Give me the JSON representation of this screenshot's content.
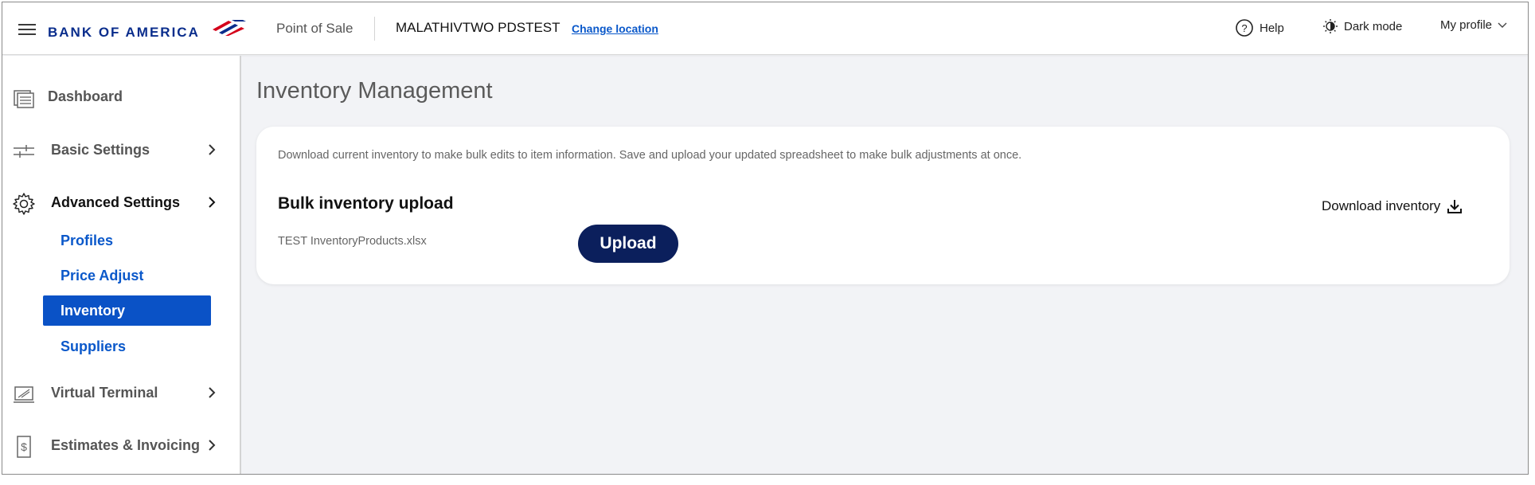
{
  "header": {
    "brand": "BANK OF AMERICA",
    "product": "Point of Sale",
    "location": "MALATHIVTWO PDSTEST",
    "change_location": "Change location",
    "help": "Help",
    "dark_mode": "Dark mode",
    "profile": "My profile",
    "brand_color": "#0a2d8c",
    "flag_red": "#d4001a"
  },
  "sidebar": {
    "items": [
      {
        "label": "Dashboard",
        "icon": "dashboard-icon"
      },
      {
        "label": "Basic Settings",
        "icon": "sliders-icon"
      },
      {
        "label": "Advanced Settings",
        "icon": "gear-icon"
      },
      {
        "label": "Virtual Terminal",
        "icon": "terminal-icon"
      },
      {
        "label": "Estimates & Invoicing",
        "icon": "invoice-icon"
      }
    ],
    "sub_items": [
      {
        "label": "Profiles"
      },
      {
        "label": "Price Adjust"
      },
      {
        "label": "Inventory"
      },
      {
        "label": "Suppliers"
      }
    ],
    "selected_color": "#0a52c6"
  },
  "main": {
    "title": "Inventory Management",
    "description": "Download current inventory to make bulk edits to item information. Save and upload your updated spreadsheet to make bulk adjustments at once.",
    "section_title": "Bulk inventory upload",
    "file_name": "TEST InventoryProducts.xlsx",
    "upload_label": "Upload",
    "download_label": "Download inventory",
    "button_color": "#0b1f5c"
  }
}
